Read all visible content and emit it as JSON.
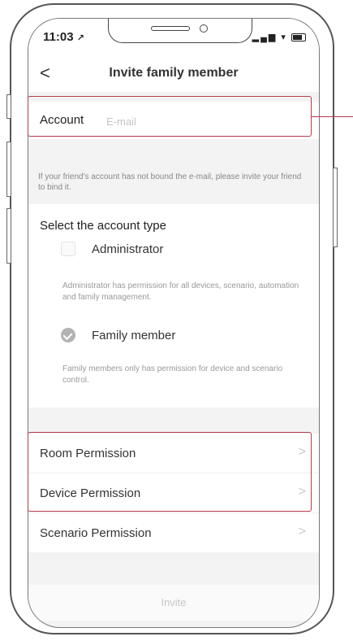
{
  "status_bar": {
    "time": "11:03",
    "location_glyph": "↗",
    "signal_glyph": "▂▄▆",
    "wifi_glyph": "▾"
  },
  "nav": {
    "back_label": "<",
    "title": "Invite family member"
  },
  "account": {
    "label": "Account",
    "placeholder": "E-mail",
    "value": ""
  },
  "hint": "If your friend's account has not bound the e-mail, please invite your friend to bind it.",
  "account_type": {
    "title": "Select the account type",
    "options": [
      {
        "label": "Administrator",
        "description": "Administrator has permission for all devices, scenario, automation and family management.",
        "selected": false
      },
      {
        "label": "Family member",
        "description": "Family members only has permission for device and scenario control.",
        "selected": true
      }
    ]
  },
  "permissions": [
    {
      "label": "Room Permission",
      "chevron": ">"
    },
    {
      "label": "Device Permission",
      "chevron": ">"
    },
    {
      "label": "Scenario Permission",
      "chevron": ">"
    }
  ],
  "invite_button": {
    "label": "Invite"
  },
  "colors": {
    "highlight": "#b9394a",
    "placeholder": "#c6c6c6",
    "checked_radio": "#b3b3b3"
  },
  "icons": [
    "location-arrow-icon",
    "signal-icon",
    "wifi-icon",
    "battery-icon",
    "back-chevron-icon",
    "checkbox-icon",
    "checked-radio-icon",
    "chevron-right-icon"
  ]
}
